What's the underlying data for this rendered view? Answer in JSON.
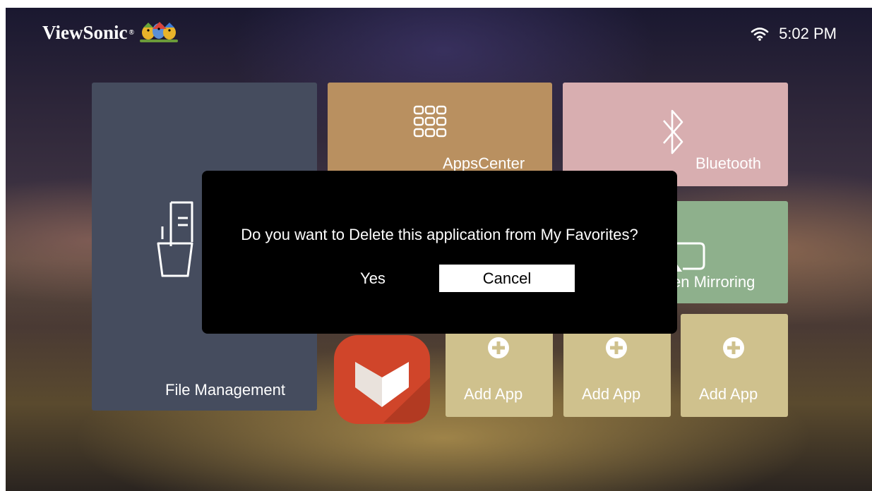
{
  "header": {
    "brand": "ViewSonic",
    "brand_reg": "®",
    "logo_icon": "birds-logo-icon",
    "wifi_icon": "wifi-icon",
    "time": "5:02 PM"
  },
  "tiles": {
    "file_management": {
      "label": "File Management",
      "icon": "file-folder-icon",
      "color": "#454c5e"
    },
    "apps_center": {
      "label": "AppsCenter",
      "icon": "apps-grid-icon",
      "color": "#b99060"
    },
    "bluetooth": {
      "label": "Bluetooth",
      "icon": "bluetooth-icon",
      "color": "#d8aeb0"
    },
    "screen_mirroring": {
      "label": "en Mirroring",
      "icon": "screen-mirroring-icon",
      "color": "#8eb08c"
    },
    "favorite_app": {
      "icon": "aptoide-app-icon"
    },
    "add_apps": [
      {
        "label": "Add App",
        "icon": "plus-circle-icon"
      },
      {
        "label": "Add App",
        "icon": "plus-circle-icon"
      },
      {
        "label": "Add App",
        "icon": "plus-circle-icon"
      }
    ],
    "add_app_color": "#cfc18d"
  },
  "dialog": {
    "message": "Do you want to Delete this application from My Favorites?",
    "yes_label": "Yes",
    "cancel_label": "Cancel"
  }
}
